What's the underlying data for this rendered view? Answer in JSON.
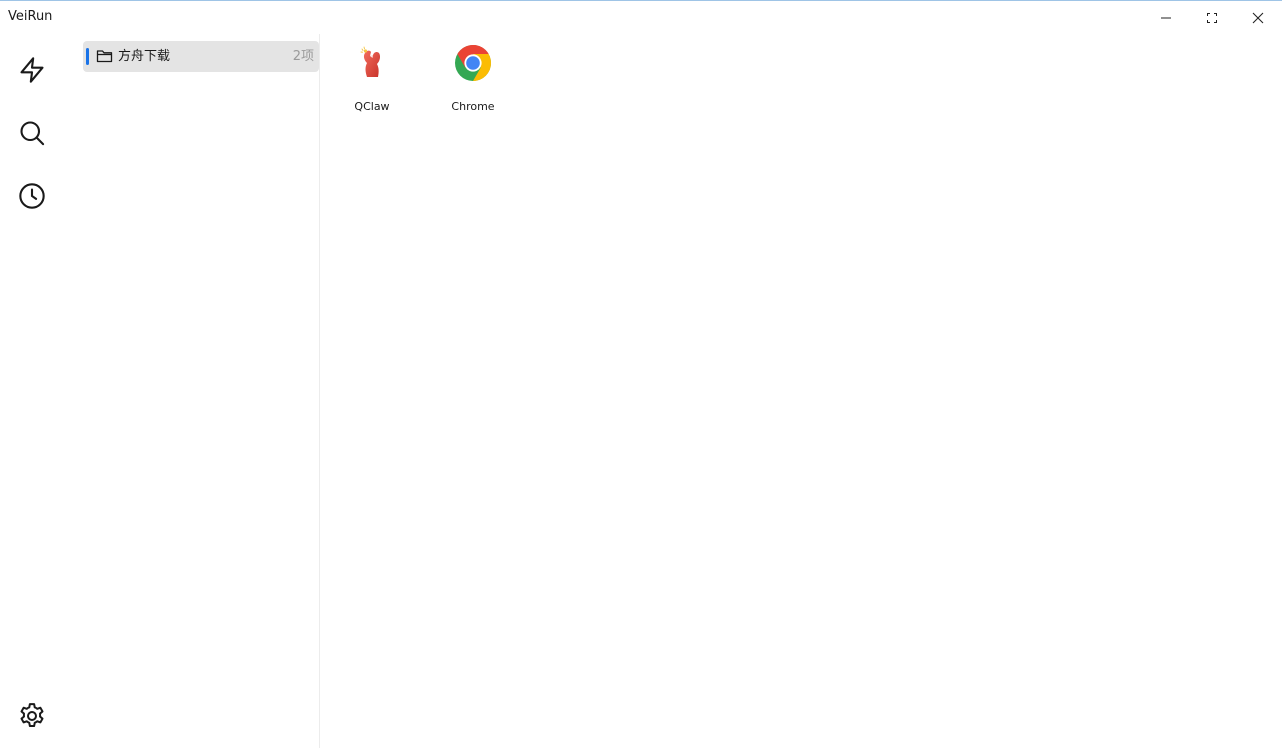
{
  "window": {
    "title": "VeiRun",
    "controls": {
      "minimize_icon": "minimize-icon",
      "maximize_icon": "maximize-icon",
      "close_icon": "close-icon"
    }
  },
  "nav": {
    "items": [
      {
        "icon": "flash-icon"
      },
      {
        "icon": "search-icon"
      },
      {
        "icon": "history-icon"
      }
    ],
    "settings_icon": "gear-icon"
  },
  "folders": [
    {
      "label": "方舟下载",
      "count": "2项",
      "icon": "folder-icon",
      "selected": true
    }
  ],
  "apps": [
    {
      "name": "QClaw",
      "icon": "qclaw-icon"
    },
    {
      "name": "Chrome",
      "icon": "chrome-icon"
    }
  ],
  "colors": {
    "accent": "#1a73e8",
    "selected_bg": "#e4e4e4",
    "count_text": "#9a9a9a",
    "border": "#ececec"
  }
}
